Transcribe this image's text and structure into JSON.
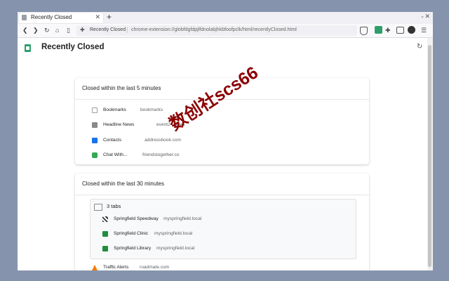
{
  "browser": {
    "tab_title": "Recently Closed",
    "new_tab_symbol": "+",
    "url_chip_label": "Recently Closed",
    "url": "chrome-extension://globfdgfdpjlfdnolabjhkbfoofpclk/html/recentlyClosed.html"
  },
  "page": {
    "title": "Recently Closed"
  },
  "sections": [
    {
      "title": "Closed within the last 5 minutes",
      "items": [
        {
          "title": "Bookmarks",
          "domain": "bookmarks",
          "icon": "bookmarks-icon",
          "color": "#9e9e9e"
        },
        {
          "title": "Headline News",
          "domain": "event24.news",
          "icon": "news-icon",
          "color": "#8a8a8a"
        },
        {
          "title": "Contacts",
          "domain": "addressbook.com",
          "icon": "contacts-icon",
          "color": "#1a73e8"
        },
        {
          "title": "Chat With...",
          "domain": "friendstogether.co",
          "icon": "chat-icon",
          "color": "#34a853"
        }
      ]
    },
    {
      "title": "Closed within the last 30 minutes",
      "group": {
        "title": "3 tabs",
        "items": [
          {
            "title": "Springfield Speedway",
            "domain": "myspringfield.local",
            "icon": "flag-icon",
            "color": "#333333"
          },
          {
            "title": "Springfield Clinic",
            "domain": "myspringfield.local",
            "icon": "clinic-icon",
            "color": "#1e8e3e"
          },
          {
            "title": "Springfield Library",
            "domain": "myspringfield.local",
            "icon": "library-icon",
            "color": "#1e8e3e"
          }
        ]
      },
      "items": [
        {
          "title": "Traffic Alerts",
          "domain": "roadmate.com",
          "icon": "cone-icon",
          "color": "#f57c00"
        }
      ]
    }
  ],
  "watermark": "数创社scs66"
}
